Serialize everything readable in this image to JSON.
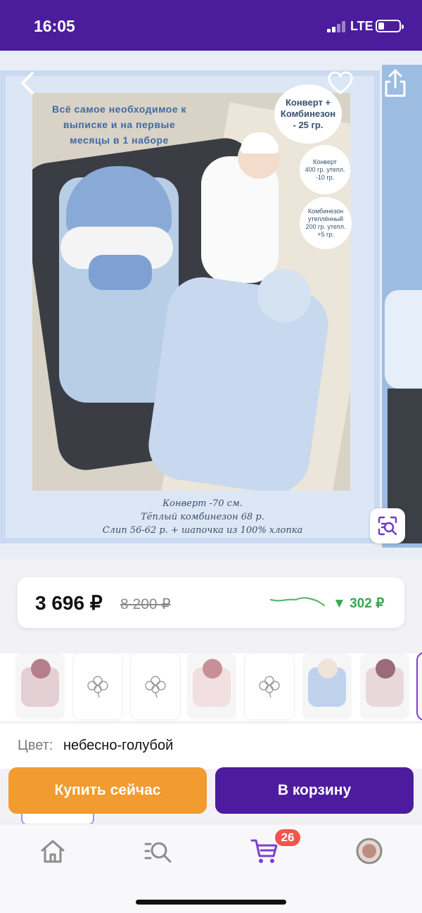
{
  "status_bar": {
    "time": "16:05",
    "network": "LTE",
    "battery_pct": 20
  },
  "hero": {
    "headline": [
      "Всё самое необходимое к",
      "выписке и на первые",
      "месяцы в 1 наборе"
    ],
    "bubbles": [
      [
        "Конверт +",
        "Комбинезон",
        "- 25 гр."
      ],
      [
        "Конверт",
        "400 гр. утепл.",
        "-10 гр."
      ],
      [
        "Комбинезон",
        "утеплённый",
        "200 гр. утепл.",
        "+5 гр."
      ]
    ],
    "caption": [
      "Конверт -70 см.",
      "Тёплый комбинезон 68 р.",
      "Слип 56-62 р. + шапочка из 100% хлопка"
    ]
  },
  "price": {
    "current": "3 696 ₽",
    "old": "8 200 ₽",
    "drop": "▼ 302 ₽",
    "colors": {
      "drop": "#3aa64f",
      "sparkline": "#5cb86a"
    }
  },
  "thumbnails": [
    {
      "kind": "photo",
      "colors": [
        "#e3cfd4",
        "#b47e8e"
      ]
    },
    {
      "kind": "placeholder",
      "icon": "flower-icon"
    },
    {
      "kind": "placeholder",
      "icon": "flower-icon"
    },
    {
      "kind": "photo",
      "colors": [
        "#f1dfe2",
        "#c98f98"
      ]
    },
    {
      "kind": "placeholder",
      "icon": "flower-icon"
    },
    {
      "kind": "photo",
      "colors": [
        "#bfd2ec",
        "#f0e3d8"
      ]
    },
    {
      "kind": "photo",
      "colors": [
        "#e8d8dc",
        "#9b6b7a"
      ]
    },
    {
      "kind": "photo-selected",
      "colors": [
        "#ffffff",
        "#ffffff"
      ]
    }
  ],
  "color": {
    "label": "Цвет:",
    "value": "небесно-голубой"
  },
  "actions": {
    "buy_now": "Купить сейчас",
    "add_to_cart": "В корзину",
    "colors": {
      "buy_now": "#f29b30",
      "add_to_cart": "#4d1c9e"
    }
  },
  "tabbar": {
    "items": [
      "home-icon",
      "catalog-search-icon",
      "cart-icon",
      "profile-avatar"
    ],
    "cart_badge": "26",
    "accent": "#7a3fd0"
  },
  "theme": {
    "brand": "#4b1c9c"
  }
}
